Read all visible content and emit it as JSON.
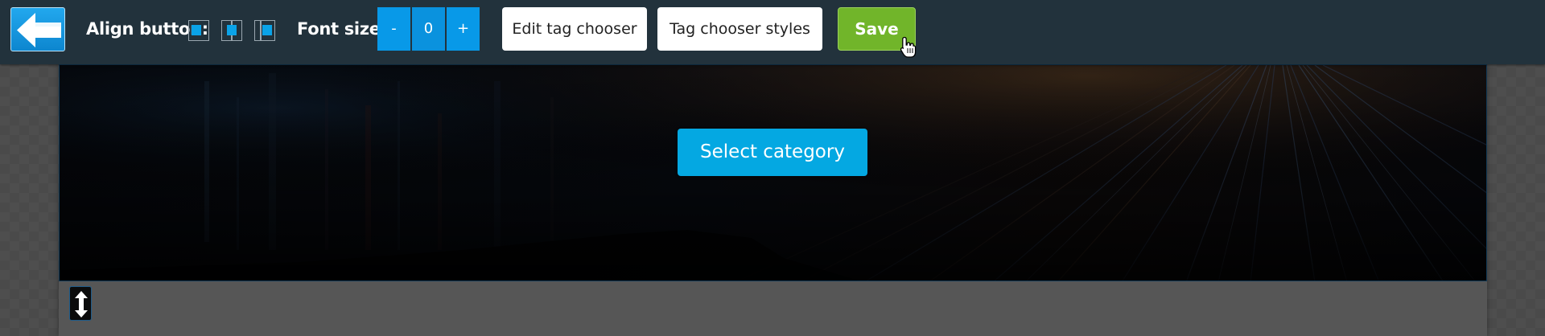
{
  "toolbar": {
    "back_icon": "arrow-left-icon",
    "align_label": "Align button:",
    "align_options": [
      "align-left-icon",
      "align-center-icon",
      "align-right-icon"
    ],
    "font_size_label": "Font size:",
    "font_decrease": "-",
    "font_size_value": "0",
    "font_increase": "+",
    "edit_tag_chooser": "Edit tag chooser",
    "tag_chooser_styles": "Tag chooser styles",
    "save": "Save",
    "cursor_icon": "hand-pointer-icon"
  },
  "banner": {
    "button_label": "Select category"
  },
  "resize": {
    "icon": "vertical-resize-icon"
  },
  "colors": {
    "toolbar_bg": "#22323c",
    "accent_blue": "#0899e8",
    "save_green": "#71b52a",
    "category_button": "#04a8e2"
  }
}
